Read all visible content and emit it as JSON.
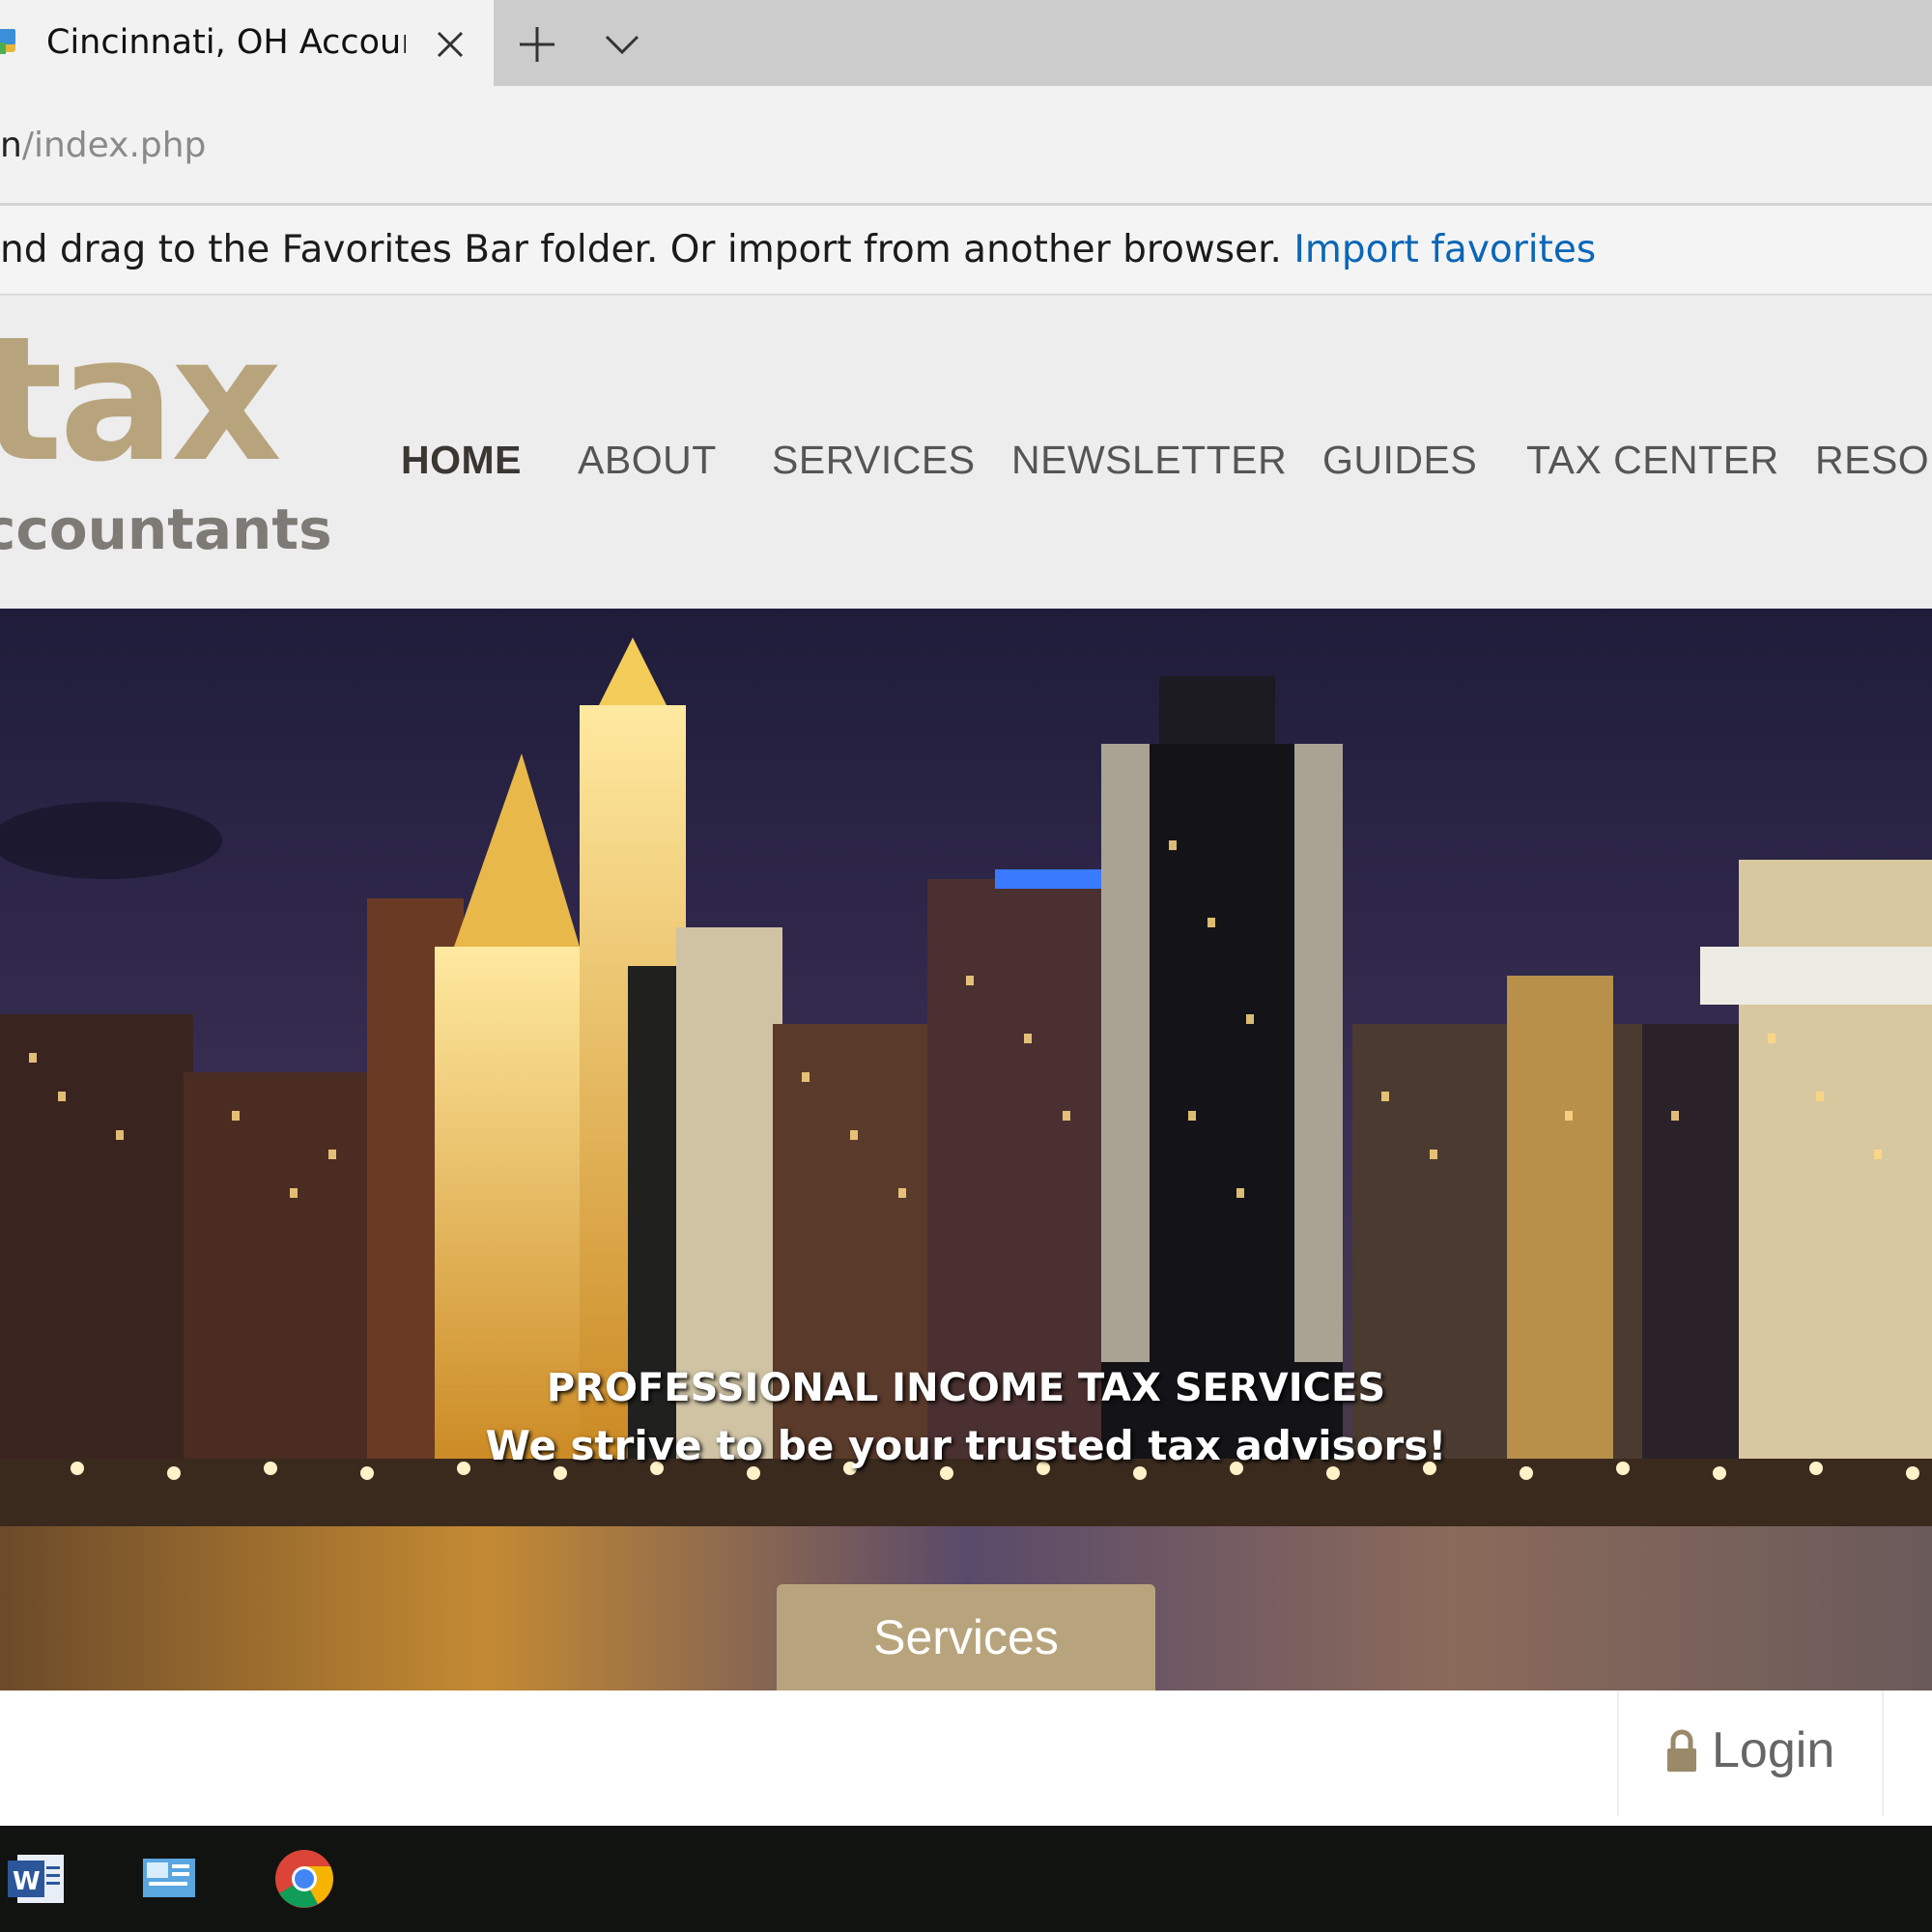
{
  "browser": {
    "tab": {
      "title": "Cincinnati, OH Accounti"
    },
    "address": {
      "url_host_tail": "n",
      "url_path": "/index.php"
    },
    "favorites_bar": {
      "message": "nd drag to the Favorites Bar folder. Or import from another browser.",
      "link": "Import favorites"
    }
  },
  "site": {
    "logo": {
      "main": "tax",
      "sub": "ccountants"
    },
    "nav": [
      {
        "label": "HOME",
        "active": true
      },
      {
        "label": "ABOUT"
      },
      {
        "label": "SERVICES"
      },
      {
        "label": "NEWSLETTER"
      },
      {
        "label": "GUIDES"
      },
      {
        "label": "TAX CENTER"
      },
      {
        "label": "RESOU"
      }
    ],
    "hero": {
      "heading": "PROFESSIONAL INCOME TAX SERVICES",
      "subheading": "We strive to be your trusted tax advisors!",
      "button": "Services"
    },
    "login": {
      "label": "Login"
    }
  },
  "colors": {
    "brand_gold": "#b8a47c",
    "logo_gray": "#7e7a75",
    "link_blue": "#0a66b7"
  },
  "taskbar": {
    "icons": [
      "word-icon",
      "control-panel-icon",
      "chrome-icon"
    ]
  }
}
